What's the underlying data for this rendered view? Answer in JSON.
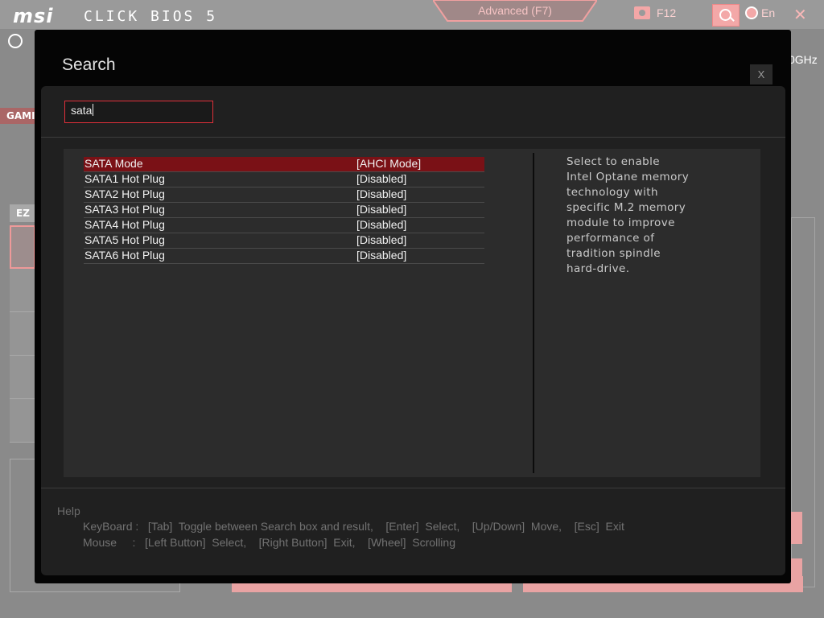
{
  "header": {
    "logo": "msi",
    "product": "CLICK BIOS 5",
    "mode_tab": "Advanced (F7)",
    "screenshot_label": "F12",
    "language_label": "En",
    "close_glyph": "✕"
  },
  "background": {
    "clock_glyph": "2",
    "cpu_speed_fragment": "0GHz",
    "game_label": "GAMI",
    "ez_label": "EZ"
  },
  "search_dialog": {
    "title": "Search",
    "close_label": "X",
    "query": "sata",
    "results": [
      {
        "name": "SATA Mode",
        "value": "[AHCI Mode]",
        "selected": true
      },
      {
        "name": "SATA1 Hot Plug",
        "value": "[Disabled]",
        "selected": false
      },
      {
        "name": "SATA2 Hot Plug",
        "value": "[Disabled]",
        "selected": false
      },
      {
        "name": "SATA3 Hot Plug",
        "value": "[Disabled]",
        "selected": false
      },
      {
        "name": "SATA4 Hot Plug",
        "value": "[Disabled]",
        "selected": false
      },
      {
        "name": "SATA5 Hot Plug",
        "value": "[Disabled]",
        "selected": false
      },
      {
        "name": "SATA6 Hot Plug",
        "value": "[Disabled]",
        "selected": false
      }
    ],
    "description_lines": [
      "Select to enable",
      "Intel Optane memory",
      "technology with",
      "specific M.2 memory",
      "module to improve",
      "performance of",
      "tradition spindle",
      "hard-drive."
    ],
    "help": {
      "title": "Help",
      "keyboard": "KeyBoard :   [Tab]  Toggle between Search box and result,    [Enter]  Select,    [Up/Down]  Move,    [Esc]  Exit",
      "mouse": "Mouse     :   [Left Button]  Select,    [Right Button]  Exit,    [Wheel]  Scrolling"
    }
  },
  "colors": {
    "accent": "#e0303a",
    "selected_row": "#7a1116",
    "panel": "#2c2c2c",
    "modal": "#050505"
  }
}
